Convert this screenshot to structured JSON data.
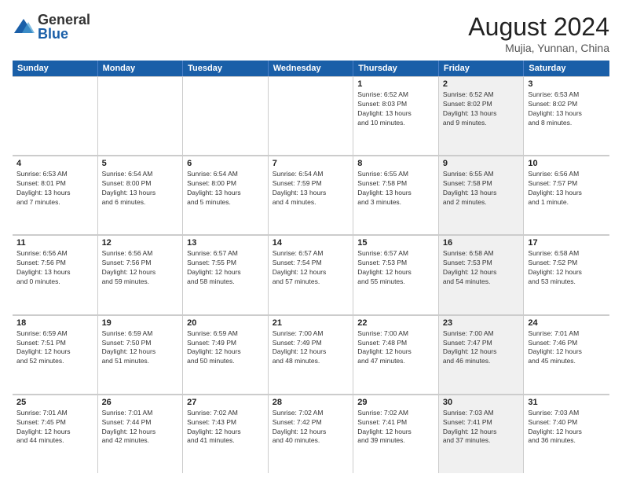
{
  "logo": {
    "general": "General",
    "blue": "Blue"
  },
  "title": "August 2024",
  "location": "Mujia, Yunnan, China",
  "weekdays": [
    "Sunday",
    "Monday",
    "Tuesday",
    "Wednesday",
    "Thursday",
    "Friday",
    "Saturday"
  ],
  "rows": [
    [
      {
        "day": "",
        "info": "",
        "shaded": false
      },
      {
        "day": "",
        "info": "",
        "shaded": false
      },
      {
        "day": "",
        "info": "",
        "shaded": false
      },
      {
        "day": "",
        "info": "",
        "shaded": false
      },
      {
        "day": "1",
        "info": "Sunrise: 6:52 AM\nSunset: 8:03 PM\nDaylight: 13 hours\nand 10 minutes.",
        "shaded": false
      },
      {
        "day": "2",
        "info": "Sunrise: 6:52 AM\nSunset: 8:02 PM\nDaylight: 13 hours\nand 9 minutes.",
        "shaded": true
      },
      {
        "day": "3",
        "info": "Sunrise: 6:53 AM\nSunset: 8:02 PM\nDaylight: 13 hours\nand 8 minutes.",
        "shaded": false
      }
    ],
    [
      {
        "day": "4",
        "info": "Sunrise: 6:53 AM\nSunset: 8:01 PM\nDaylight: 13 hours\nand 7 minutes.",
        "shaded": false
      },
      {
        "day": "5",
        "info": "Sunrise: 6:54 AM\nSunset: 8:00 PM\nDaylight: 13 hours\nand 6 minutes.",
        "shaded": false
      },
      {
        "day": "6",
        "info": "Sunrise: 6:54 AM\nSunset: 8:00 PM\nDaylight: 13 hours\nand 5 minutes.",
        "shaded": false
      },
      {
        "day": "7",
        "info": "Sunrise: 6:54 AM\nSunset: 7:59 PM\nDaylight: 13 hours\nand 4 minutes.",
        "shaded": false
      },
      {
        "day": "8",
        "info": "Sunrise: 6:55 AM\nSunset: 7:58 PM\nDaylight: 13 hours\nand 3 minutes.",
        "shaded": false
      },
      {
        "day": "9",
        "info": "Sunrise: 6:55 AM\nSunset: 7:58 PM\nDaylight: 13 hours\nand 2 minutes.",
        "shaded": true
      },
      {
        "day": "10",
        "info": "Sunrise: 6:56 AM\nSunset: 7:57 PM\nDaylight: 13 hours\nand 1 minute.",
        "shaded": false
      }
    ],
    [
      {
        "day": "11",
        "info": "Sunrise: 6:56 AM\nSunset: 7:56 PM\nDaylight: 13 hours\nand 0 minutes.",
        "shaded": false
      },
      {
        "day": "12",
        "info": "Sunrise: 6:56 AM\nSunset: 7:56 PM\nDaylight: 12 hours\nand 59 minutes.",
        "shaded": false
      },
      {
        "day": "13",
        "info": "Sunrise: 6:57 AM\nSunset: 7:55 PM\nDaylight: 12 hours\nand 58 minutes.",
        "shaded": false
      },
      {
        "day": "14",
        "info": "Sunrise: 6:57 AM\nSunset: 7:54 PM\nDaylight: 12 hours\nand 57 minutes.",
        "shaded": false
      },
      {
        "day": "15",
        "info": "Sunrise: 6:57 AM\nSunset: 7:53 PM\nDaylight: 12 hours\nand 55 minutes.",
        "shaded": false
      },
      {
        "day": "16",
        "info": "Sunrise: 6:58 AM\nSunset: 7:53 PM\nDaylight: 12 hours\nand 54 minutes.",
        "shaded": true
      },
      {
        "day": "17",
        "info": "Sunrise: 6:58 AM\nSunset: 7:52 PM\nDaylight: 12 hours\nand 53 minutes.",
        "shaded": false
      }
    ],
    [
      {
        "day": "18",
        "info": "Sunrise: 6:59 AM\nSunset: 7:51 PM\nDaylight: 12 hours\nand 52 minutes.",
        "shaded": false
      },
      {
        "day": "19",
        "info": "Sunrise: 6:59 AM\nSunset: 7:50 PM\nDaylight: 12 hours\nand 51 minutes.",
        "shaded": false
      },
      {
        "day": "20",
        "info": "Sunrise: 6:59 AM\nSunset: 7:49 PM\nDaylight: 12 hours\nand 50 minutes.",
        "shaded": false
      },
      {
        "day": "21",
        "info": "Sunrise: 7:00 AM\nSunset: 7:49 PM\nDaylight: 12 hours\nand 48 minutes.",
        "shaded": false
      },
      {
        "day": "22",
        "info": "Sunrise: 7:00 AM\nSunset: 7:48 PM\nDaylight: 12 hours\nand 47 minutes.",
        "shaded": false
      },
      {
        "day": "23",
        "info": "Sunrise: 7:00 AM\nSunset: 7:47 PM\nDaylight: 12 hours\nand 46 minutes.",
        "shaded": true
      },
      {
        "day": "24",
        "info": "Sunrise: 7:01 AM\nSunset: 7:46 PM\nDaylight: 12 hours\nand 45 minutes.",
        "shaded": false
      }
    ],
    [
      {
        "day": "25",
        "info": "Sunrise: 7:01 AM\nSunset: 7:45 PM\nDaylight: 12 hours\nand 44 minutes.",
        "shaded": false
      },
      {
        "day": "26",
        "info": "Sunrise: 7:01 AM\nSunset: 7:44 PM\nDaylight: 12 hours\nand 42 minutes.",
        "shaded": false
      },
      {
        "day": "27",
        "info": "Sunrise: 7:02 AM\nSunset: 7:43 PM\nDaylight: 12 hours\nand 41 minutes.",
        "shaded": false
      },
      {
        "day": "28",
        "info": "Sunrise: 7:02 AM\nSunset: 7:42 PM\nDaylight: 12 hours\nand 40 minutes.",
        "shaded": false
      },
      {
        "day": "29",
        "info": "Sunrise: 7:02 AM\nSunset: 7:41 PM\nDaylight: 12 hours\nand 39 minutes.",
        "shaded": false
      },
      {
        "day": "30",
        "info": "Sunrise: 7:03 AM\nSunset: 7:41 PM\nDaylight: 12 hours\nand 37 minutes.",
        "shaded": true
      },
      {
        "day": "31",
        "info": "Sunrise: 7:03 AM\nSunset: 7:40 PM\nDaylight: 12 hours\nand 36 minutes.",
        "shaded": false
      }
    ]
  ]
}
